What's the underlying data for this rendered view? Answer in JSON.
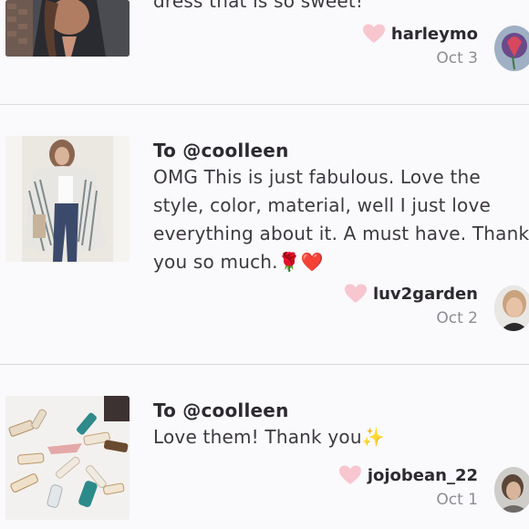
{
  "comments": [
    {
      "recipient": "",
      "message": "dress that is so sweet!",
      "username": "harleymo",
      "date": "Oct 3"
    },
    {
      "recipient": "To @coolleen",
      "message": "OMG This is just fabulous. Love the style, color, material, well I just love everything about it. A must have. Thank you so much.🌹❤️",
      "username": "luv2garden",
      "date": "Oct 2"
    },
    {
      "recipient": "To @coolleen",
      "message": "Love them! Thank you✨",
      "username": "jojobean_22",
      "date": "Oct 1"
    }
  ],
  "icons": {
    "like": "heart-icon",
    "heart_color": "#f7c6cf"
  }
}
